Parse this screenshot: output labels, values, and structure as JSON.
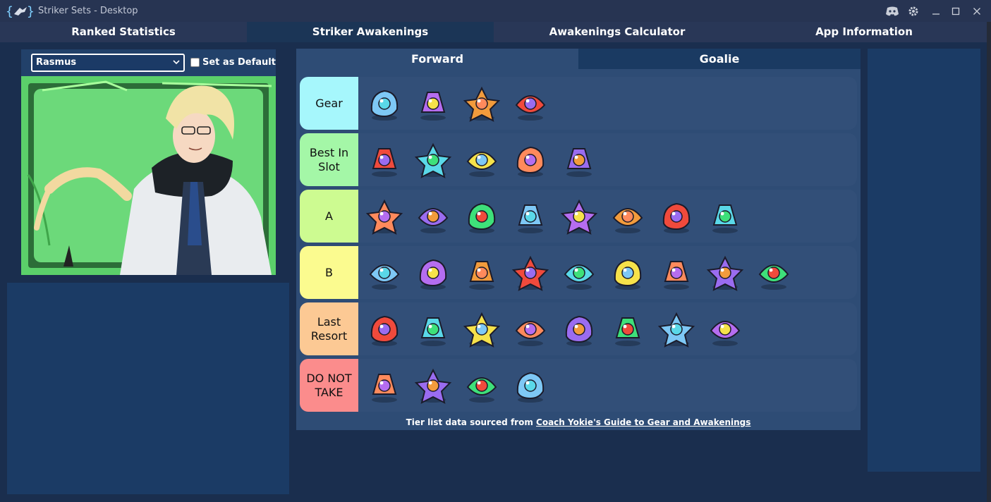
{
  "window": {
    "title": "Striker Sets - Desktop"
  },
  "tabs": [
    "Ranked Statistics",
    "Striker Awakenings",
    "Awakenings Calculator",
    "App Information"
  ],
  "striker": {
    "selected": "Rasmus",
    "default_label": "Set as Default"
  },
  "subtabs": [
    "Forward",
    "Goalie"
  ],
  "tiers": [
    {
      "label": "Gear",
      "color": "#a6f7fc",
      "items": [
        "jelly-gear-icon",
        "sneaker-gear-icon",
        "castle-gear-icon",
        "gauntlet-gear-icon"
      ]
    },
    {
      "label": "Best In Slot",
      "color": "#a4f7a7",
      "items": [
        "robot-awakening-icon",
        "hourglass-awakening-icon",
        "fox-awakening-icon",
        "gem-awakening-icon",
        "tv-awakening-icon"
      ]
    },
    {
      "label": "A",
      "color": "#cdfb91",
      "items": [
        "wings-awakening-icon",
        "fireball-awakening-icon",
        "can-awakening-icon",
        "shark-awakening-icon",
        "rocket-awakening-icon",
        "flame-awakening-icon",
        "popcorn-awakening-icon",
        "cherry-awakening-icon"
      ]
    },
    {
      "label": "B",
      "color": "#fbfb8f",
      "items": [
        "star-awakening-icon",
        "top-hat-awakening-icon",
        "mask-awakening-icon",
        "cannon-awakening-icon",
        "cat-awakening-icon",
        "clock-awakening-icon",
        "pancake-awakening-icon",
        "leaf-awakening-icon",
        "target-awakening-icon"
      ]
    },
    {
      "label": "Last Resort",
      "color": "#fcc994",
      "items": [
        "bee-awakening-icon",
        "dumbbell-awakening-icon",
        "fist-awakening-icon",
        "witch-awakening-icon",
        "serpent-awakening-icon",
        "coin-awakening-icon",
        "bow-awakening-icon",
        "orbs-awakening-icon"
      ]
    },
    {
      "label": "DO NOT TAKE",
      "color": "#fb8c8c",
      "items": [
        "pillar-awakening-icon",
        "cactus-awakening-icon",
        "comet-awakening-icon",
        "orange-fox-awakening-icon"
      ]
    }
  ],
  "footer": {
    "prefix": "Tier list data sourced from ",
    "link": "Coach Yokie's Guide to Gear and Awakenings"
  },
  "colors": {
    "accent": "#1b3556",
    "titlebar": "#273452",
    "background": "#1a2e4e"
  }
}
